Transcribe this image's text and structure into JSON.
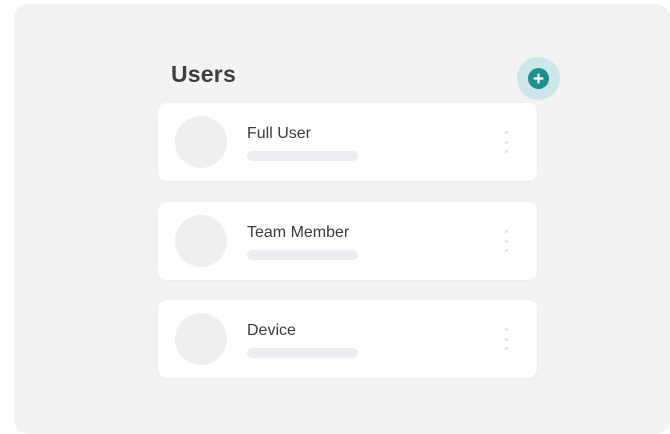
{
  "header": {
    "title": "Users"
  },
  "add_button": {
    "icon": "plus-circle-icon",
    "accent_color": "#1f8f8d",
    "halo_color": "#cde7e8"
  },
  "users": [
    {
      "label": "Full User"
    },
    {
      "label": "Team Member"
    },
    {
      "label": "Device"
    }
  ]
}
